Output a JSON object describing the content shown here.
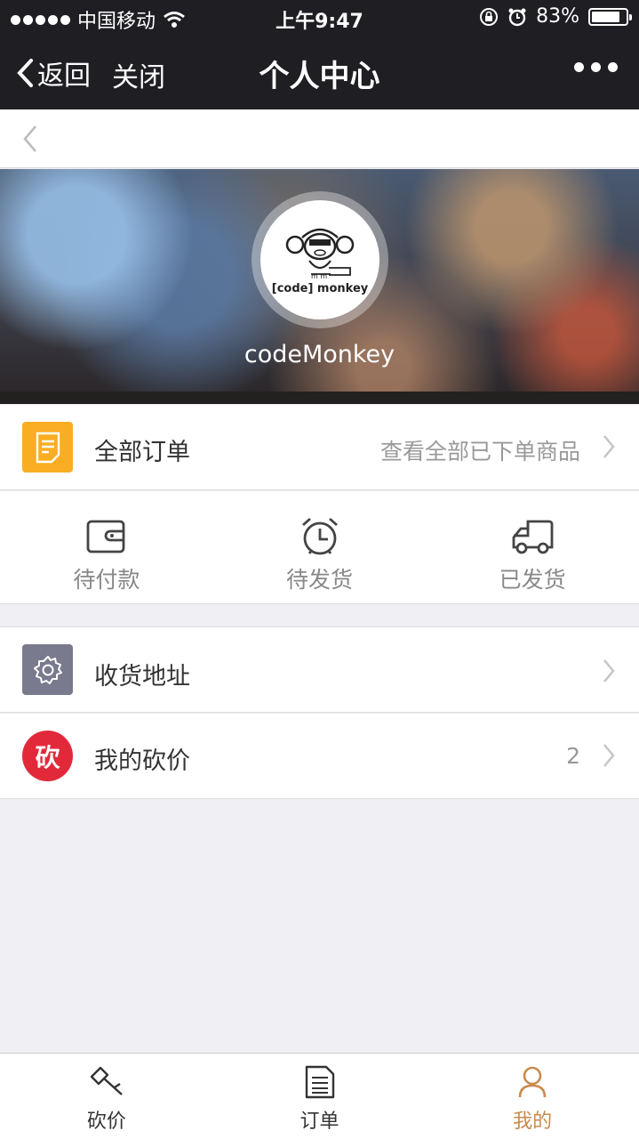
{
  "status_bar": {
    "carrier": "中国移动",
    "time": "上午9:47",
    "battery_text": "83%",
    "battery_level": 0.83
  },
  "navbar": {
    "back_label": "返回",
    "close_label": "关闭",
    "title": "个人中心"
  },
  "profile": {
    "avatar_text": "[code] monkey",
    "username": "codeMonkey"
  },
  "orders": {
    "label": "全部订单",
    "hint": "查看全部已下单商品",
    "icon": "document-icon",
    "icon_color": "#f9ad23"
  },
  "order_status": [
    {
      "label": "待付款",
      "icon": "wallet-icon"
    },
    {
      "label": "待发货",
      "icon": "alarm-clock-icon"
    },
    {
      "label": "已发货",
      "icon": "truck-icon"
    }
  ],
  "menu": {
    "address": {
      "label": "收货地址",
      "icon": "gear-icon",
      "icon_color": "#7a7a8e"
    },
    "bargain": {
      "label": "我的砍价",
      "badge_char": "砍",
      "count": "2",
      "icon_color": "#e2293a"
    }
  },
  "tabs": [
    {
      "label": "砍价",
      "icon": "axe-icon",
      "active": false
    },
    {
      "label": "订单",
      "icon": "list-icon",
      "active": false
    },
    {
      "label": "我的",
      "icon": "user-icon",
      "active": true
    }
  ],
  "colors": {
    "nav_bg": "#1f1e23",
    "accent": "#c98a4c",
    "page_bg": "#efeff4"
  }
}
